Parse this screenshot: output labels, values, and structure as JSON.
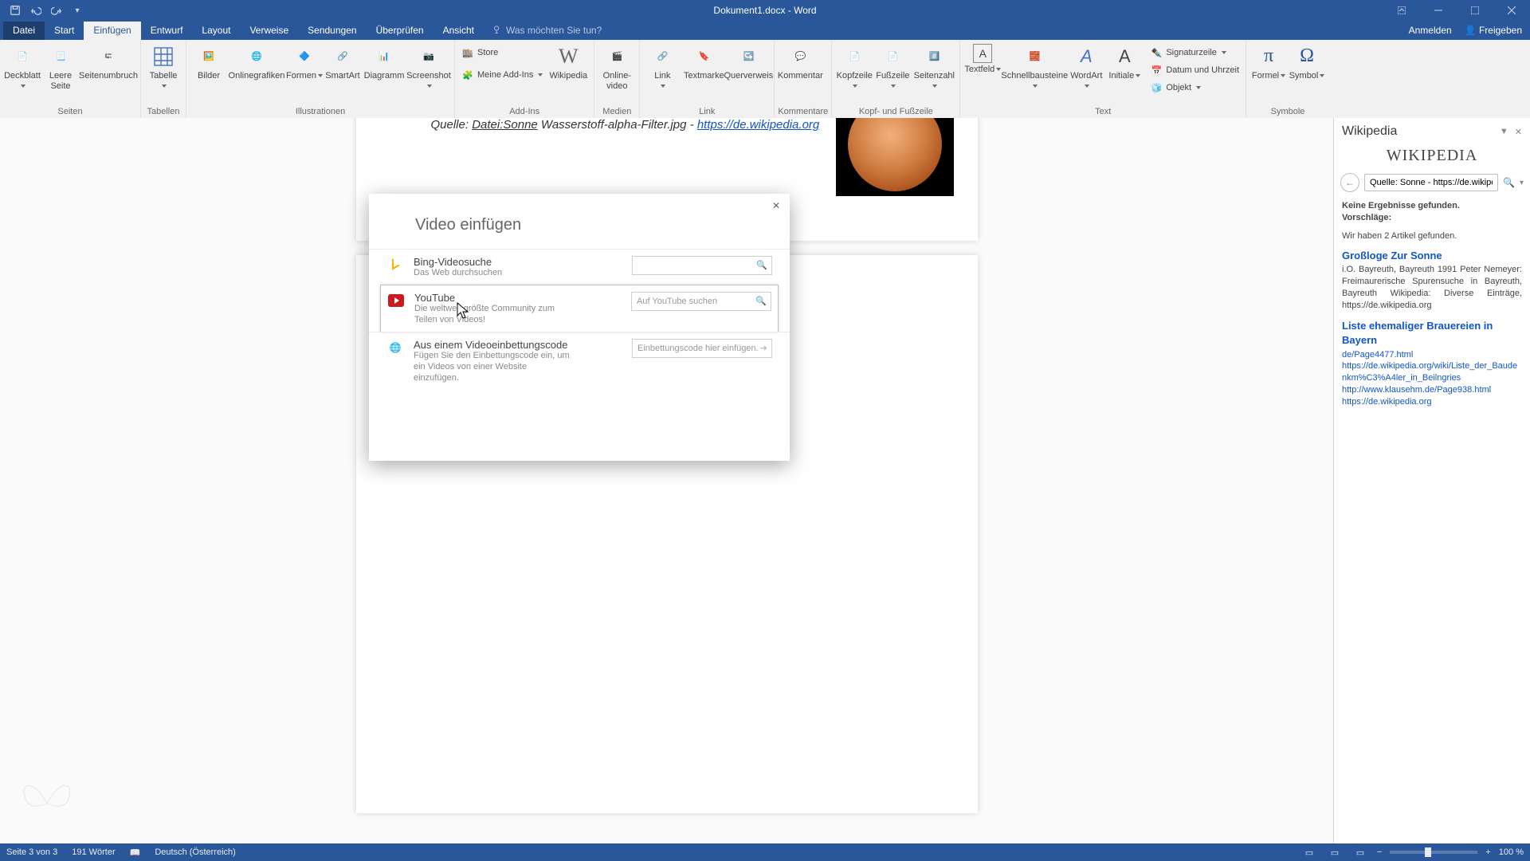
{
  "titlebar": {
    "title": "Dokument1.docx - Word"
  },
  "tabs": {
    "file": "Datei",
    "items": [
      "Start",
      "Einfügen",
      "Entwurf",
      "Layout",
      "Verweise",
      "Sendungen",
      "Überprüfen",
      "Ansicht"
    ],
    "active_index": 1,
    "tellme_placeholder": "Was möchten Sie tun?",
    "signin": "Anmelden",
    "share": "Freigeben"
  },
  "ribbon": {
    "seiten": {
      "deckblatt": "Deckblatt",
      "leere": "Leere Seite",
      "seitenumbruch": "Seitenumbruch",
      "label": "Seiten"
    },
    "tabellen": {
      "tabelle": "Tabelle",
      "label": "Tabellen"
    },
    "illustrationen": {
      "bilder": "Bilder",
      "onlinegrafiken": "Onlinegrafiken",
      "formen": "Formen",
      "smartart": "SmartArt",
      "diagramm": "Diagramm",
      "screenshot": "Screenshot",
      "label": "Illustrationen"
    },
    "addins": {
      "store": "Store",
      "meine": "Meine Add-Ins",
      "label": "Add-Ins"
    },
    "wikipedia": "Wikipedia",
    "medien": {
      "video": "Online-video",
      "label": "Medien"
    },
    "link": {
      "link": "Link",
      "textmarke": "Textmarke",
      "querverweis": "Querverweis",
      "label": "Link"
    },
    "kommentare": {
      "kommentar": "Kommentar",
      "label": "Kommentare"
    },
    "kopf": {
      "kopfzeile": "Kopfzeile",
      "fusszeile": "Fußzeile",
      "seitenzahl": "Seitenzahl",
      "label": "Kopf- und Fußzeile"
    },
    "text": {
      "textfeld": "Textfeld",
      "schnell": "Schnellbausteine",
      "wordart": "WordArt",
      "initiale": "Initiale",
      "signatur": "Signaturzeile",
      "datum": "Datum und Uhrzeit",
      "objekt": "Objekt",
      "label": "Text"
    },
    "symbole": {
      "formel": "Formel",
      "symbol": "Symbol",
      "label": "Symbole"
    }
  },
  "document": {
    "caption_prefix": "Quelle: ",
    "caption_file": "Datei:Sonne",
    "caption_mid": " Wasserstoff-alpha-Filter.jpg - ",
    "caption_url": "https://de.wikipedia.org"
  },
  "dialog": {
    "title": "Video einfügen",
    "bing": {
      "name": "Bing-Videosuche",
      "desc": "Das Web durchsuchen"
    },
    "youtube": {
      "name": "YouTube",
      "desc": "Die weltweit größte Community zum Teilen von Videos!",
      "placeholder": "Auf YouTube suchen"
    },
    "embed": {
      "name": "Aus einem Videoeinbettungscode",
      "desc": "Fügen Sie den Einbettungscode ein, um ein Videos von einer Website einzufügen.",
      "placeholder": "Einbettungscode hier einfügen."
    }
  },
  "wikipedia": {
    "pane_title": "Wikipedia",
    "logo": "WIKIPEDIA",
    "search_value": "Quelle: Sonne - https://de.wikipedia.org",
    "noresults": "Keine Ergebnisse gefunden.",
    "suggestions": "Vorschläge:",
    "found": "Wir haben 2 Artikel gefunden.",
    "r1_title": "Großloge Zur Sonne",
    "r1_body": "i.O. Bayreuth, Bayreuth 1991 Peter Nemeyer: Freimaurerische Spurensuche in Bayreuth, Bayreuth Wikipedia: Diverse Einträge, https://de.wikipedia.org",
    "r2_title": "Liste ehemaliger Brauereien in Bayern",
    "r2_links": [
      "de/Page4477.html",
      "https://de.wikipedia.org/wiki/Liste_der_Baudenkm%C3%A4ler_in_Beilngries",
      "http://www.klausehm.de/Page938.html",
      "https://de.wikipedia.org"
    ]
  },
  "status": {
    "page": "Seite 3 von 3",
    "words": "191 Wörter",
    "lang": "Deutsch (Österreich)",
    "zoom": "100 %"
  }
}
